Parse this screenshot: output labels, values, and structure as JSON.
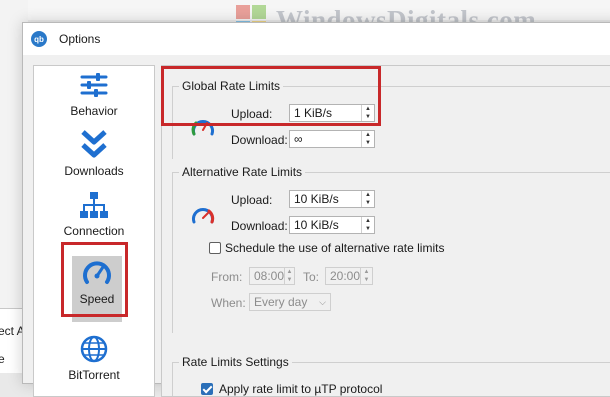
{
  "watermark": {
    "text": "WindowsDigitals.com"
  },
  "background": {
    "text_fragment_1": "ect A",
    "text_fragment_2": "e"
  },
  "window": {
    "title": "Options",
    "app_icon_text": "qb"
  },
  "sidebar": {
    "items": [
      {
        "label": "Behavior",
        "icon": "sliders-icon"
      },
      {
        "label": "Downloads",
        "icon": "double-chevron-down-icon"
      },
      {
        "label": "Connection",
        "icon": "network-icon"
      },
      {
        "label": "Speed",
        "icon": "speedometer-icon",
        "selected": true
      },
      {
        "label": "BitTorrent",
        "icon": "globe-icon"
      }
    ]
  },
  "global_rate_limits": {
    "title": "Global Rate Limits",
    "upload_label": "Upload:",
    "upload_value": "1 KiB/s",
    "download_label": "Download:",
    "download_value": "∞"
  },
  "alternative_rate_limits": {
    "title": "Alternative Rate Limits",
    "upload_label": "Upload:",
    "upload_value": "10 KiB/s",
    "download_label": "Download:",
    "download_value": "10 KiB/s",
    "schedule_label": "Schedule the use of alternative rate limits",
    "schedule_checked": false,
    "from_label": "From:",
    "from_value": "08:00",
    "to_label": "To:",
    "to_value": "20:00",
    "when_label": "When:",
    "when_value": "Every day"
  },
  "rate_limits_settings": {
    "title": "Rate Limits Settings",
    "utp_label": "Apply rate limit to µTP protocol",
    "utp_checked": true
  },
  "colors": {
    "highlight": "#c8282a",
    "accent_blue": "#1e6fd0",
    "selected_bg": "#cdcdcd"
  }
}
